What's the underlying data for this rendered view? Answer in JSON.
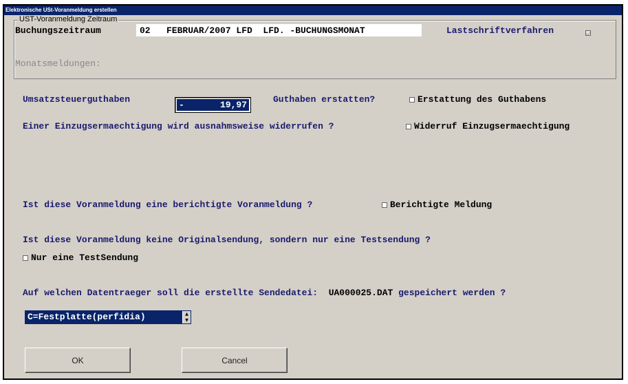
{
  "window": {
    "title": "Elektronische USt-Voranmeldung erstellen"
  },
  "group": {
    "legend": "UST-Voranmeldung Zeitraum",
    "period_label": "Buchungszeitraum",
    "period_value": "02   FEBRUAR/2007 LFD  LFD. -BUCHUNGSMONAT",
    "debit_label": "Lastschriftverfahren",
    "debit_checked": true,
    "monthly_label": "Monatsmeldungen:"
  },
  "credit": {
    "label": "Umsatzsteuerguthaben",
    "sign": "-",
    "value": "19,97",
    "refund_question": "Guthaben erstatten?",
    "refund_checkbox": "Erstattung des Guthabens"
  },
  "revoke": {
    "question": "Einer Einzugsermaechtigung wird ausnahmsweise widerrufen ?",
    "checkbox": "Widerruf Einzugsermaechtigung"
  },
  "corrected": {
    "question": "Ist diese Voranmeldung eine berichtigte Voranmeldung ?",
    "checkbox": "Berichtigte Meldung"
  },
  "test": {
    "question": "Ist diese Voranmeldung keine Originalsendung, sondern nur eine Testsendung ?",
    "checkbox": "Nur eine TestSendung"
  },
  "storage": {
    "question_prefix": "Auf welchen Datentraeger soll die erstellte Sendedatei:",
    "filename": "UA000025.DAT",
    "question_suffix": "gespeichert werden ?",
    "selected": "C=Festplatte(perfidia)"
  },
  "buttons": {
    "ok": "OK",
    "cancel": "Cancel"
  },
  "colors": {
    "title_bg": "#0a246a",
    "label_text": "#1a1a6e",
    "window_bg": "#d4d0c8"
  }
}
